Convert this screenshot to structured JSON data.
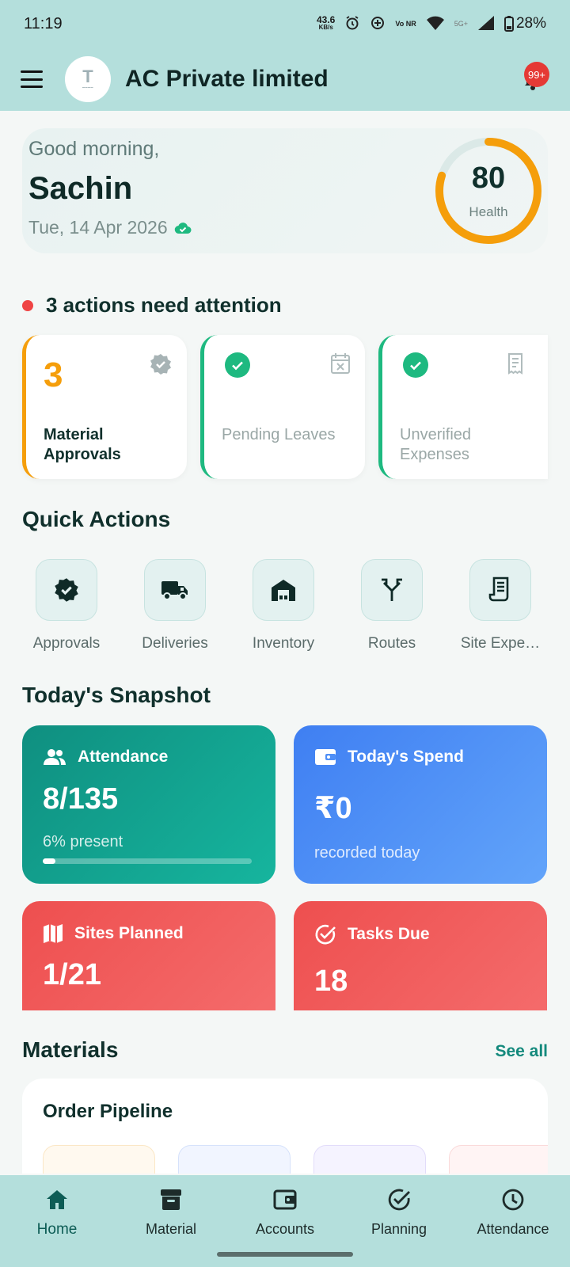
{
  "status_bar": {
    "time": "11:19",
    "net_speed": "43.6",
    "net_unit": "KB/s",
    "network": "Vo NR",
    "signal_5g": "5G+",
    "battery": "28%"
  },
  "header": {
    "company_name": "AC Private limited",
    "notification_count": "99+"
  },
  "greeting": {
    "salutation": "Good morning,",
    "user_name": "Sachin",
    "date": "Tue, 14 Apr 2026",
    "health_score": "80",
    "health_label": "Health",
    "health_fraction": 0.8
  },
  "attention": {
    "title": "3 actions need attention",
    "cards": [
      {
        "count": "3",
        "label": "Material Approvals",
        "status": "pending",
        "icon": "verified-badge-icon"
      },
      {
        "count": "",
        "label": "Pending Leaves",
        "status": "done",
        "icon": "calendar-x-icon"
      },
      {
        "count": "",
        "label": "Unverified Expenses",
        "status": "done",
        "icon": "receipt-icon"
      }
    ]
  },
  "quick_actions": {
    "title": "Quick Actions",
    "items": [
      {
        "label": "Approvals",
        "icon": "verified-badge-icon"
      },
      {
        "label": "Deliveries",
        "icon": "truck-icon"
      },
      {
        "label": "Inventory",
        "icon": "warehouse-icon"
      },
      {
        "label": "Routes",
        "icon": "routes-icon"
      },
      {
        "label": "Site Expe…",
        "icon": "receipt-icon"
      }
    ]
  },
  "snapshot": {
    "title": "Today's Snapshot",
    "attendance": {
      "label": "Attendance",
      "value": "8/135",
      "sub": "6% present",
      "progress": 0.06
    },
    "spend": {
      "label": "Today's Spend",
      "value": "₹0",
      "sub": "recorded today"
    },
    "sites": {
      "label": "Sites Planned",
      "value": "1/21"
    },
    "tasks": {
      "label": "Tasks Due",
      "value": "18"
    }
  },
  "materials": {
    "title": "Materials",
    "see_all": "See all",
    "pipeline_title": "Order Pipeline"
  },
  "bottom_nav": [
    {
      "label": "Home",
      "icon": "home-icon",
      "active": true
    },
    {
      "label": "Material",
      "icon": "archive-box-icon",
      "active": false
    },
    {
      "label": "Accounts",
      "icon": "wallet-icon",
      "active": false
    },
    {
      "label": "Planning",
      "icon": "check-circle-icon",
      "active": false
    },
    {
      "label": "Attendance",
      "icon": "clock-icon",
      "active": false
    }
  ],
  "colors": {
    "header_bg": "#b4dfdc",
    "amber": "#f59e0b",
    "green": "#1eb980",
    "teal_card": "#14a190",
    "blue_card": "#4f8ff7",
    "red_card": "#f05a5a",
    "link": "#13897c"
  }
}
